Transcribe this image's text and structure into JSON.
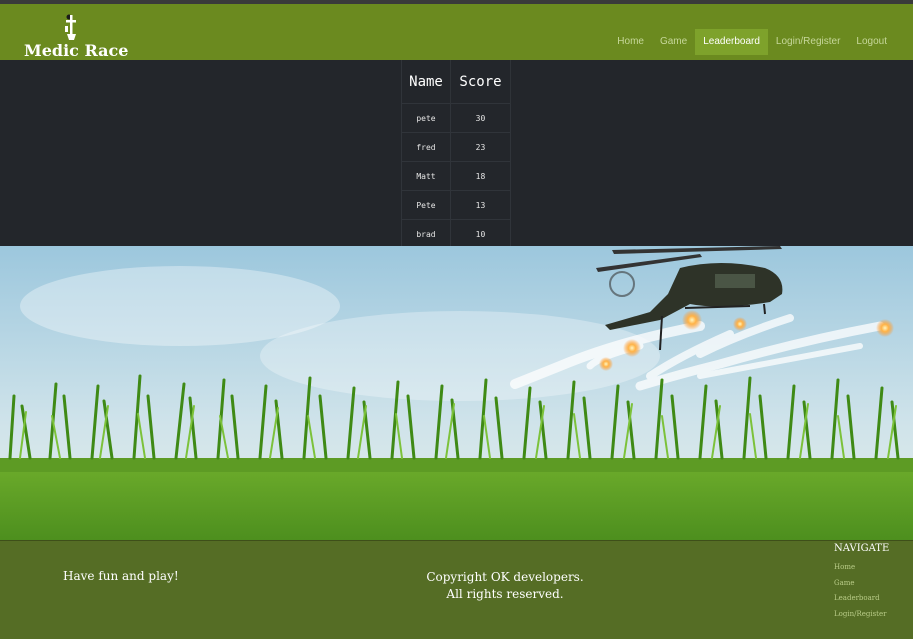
{
  "brand": {
    "name": "Medic Race"
  },
  "nav": {
    "items": [
      {
        "label": "Home"
      },
      {
        "label": "Game"
      },
      {
        "label": "Leaderboard",
        "active": true
      },
      {
        "label": "Login/Register"
      },
      {
        "label": "Logout"
      }
    ]
  },
  "leaderboard": {
    "headers": [
      "Name",
      "Score"
    ],
    "rows": [
      {
        "name": "pete",
        "score": "30"
      },
      {
        "name": "fred",
        "score": "23"
      },
      {
        "name": "Matt",
        "score": "18"
      },
      {
        "name": "Pete",
        "score": "13"
      },
      {
        "name": "brad",
        "score": "10"
      }
    ]
  },
  "footer": {
    "tagline": "Have fun and play!",
    "copyright_line1": "Copyright OK developers.",
    "copyright_line2": "All rights reserved.",
    "nav_title": "NAVIGATE",
    "links": [
      {
        "label": "Home"
      },
      {
        "label": "Game"
      },
      {
        "label": "Leaderboard"
      },
      {
        "label": "Login/Register"
      }
    ]
  },
  "colors": {
    "navbar": "#6b8a1f",
    "nav_active": "#7ea22b",
    "table_bg": "#23262b",
    "footer": "#556d25"
  }
}
